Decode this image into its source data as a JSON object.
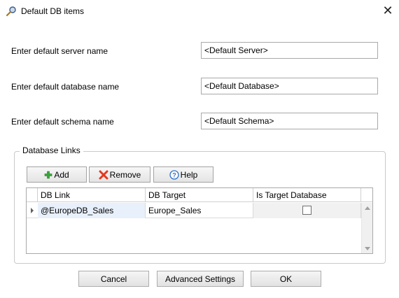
{
  "window": {
    "title": "Default DB items",
    "icon": "key-search-icon"
  },
  "fields": [
    {
      "label": "Enter default server name",
      "value": "<Default Server>"
    },
    {
      "label": "Enter default database name",
      "value": "<Default Database>"
    },
    {
      "label": "Enter default schema name",
      "value": "<Default Schema>"
    }
  ],
  "links": {
    "group_title": "Database Links",
    "toolbar": {
      "add_label": "Add",
      "add_icon": "plus-icon",
      "remove_label": "Remove",
      "remove_icon": "x-icon",
      "help_label": "Help",
      "help_icon": "help-icon"
    },
    "columns": [
      "DB Link",
      "DB Target",
      "Is Target Database"
    ],
    "rows": [
      {
        "db_link": "@EuropeDB_Sales",
        "db_target": "Europe_Sales",
        "is_target": false
      }
    ]
  },
  "buttons": {
    "cancel": "Cancel",
    "advanced": "Advanced Settings",
    "ok": "OK"
  },
  "colors": {
    "add_green": "#3aa63a",
    "remove_red": "#e23a1f",
    "help_blue": "#2f6fcb"
  }
}
